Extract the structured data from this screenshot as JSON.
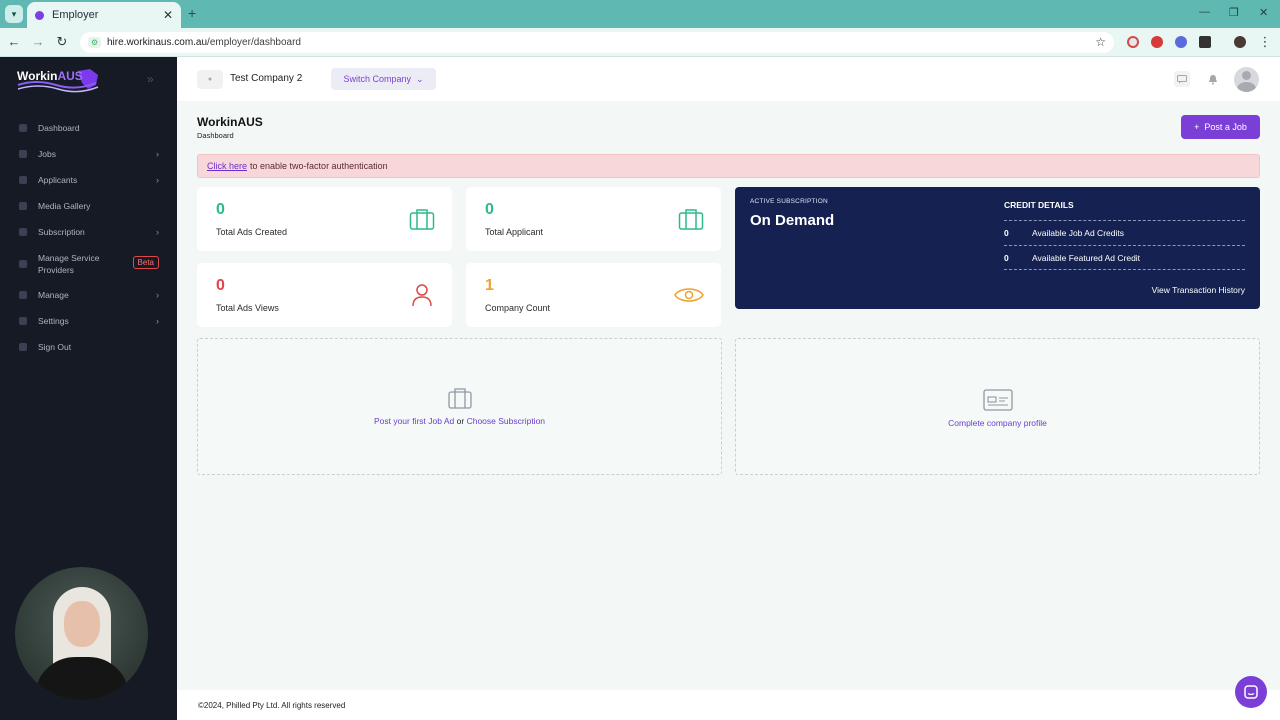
{
  "browser": {
    "tab_title": "Employer",
    "tab_close": "✕",
    "new_tab": "+",
    "url_host": "hire.workinaus.com.au",
    "url_path": "/employer/dashboard",
    "window_controls": [
      "—",
      "❐",
      "✕"
    ]
  },
  "sidebar": {
    "logo_text_a": "Workin",
    "logo_text_b": "AUS",
    "items": [
      {
        "label": "Dashboard",
        "icon": "dashboard-icon",
        "chevron": false
      },
      {
        "label": "Jobs",
        "icon": "jobs-icon",
        "chevron": true
      },
      {
        "label": "Applicants",
        "icon": "applicants-icon",
        "chevron": true
      },
      {
        "label": "Media Gallery",
        "icon": "media-icon",
        "chevron": false
      },
      {
        "label": "Subscription",
        "icon": "subscription-icon",
        "chevron": true
      },
      {
        "label": "Manage Service Providers",
        "icon": "providers-icon",
        "chevron": false,
        "badge": "Beta"
      },
      {
        "label": "Manage",
        "icon": "manage-icon",
        "chevron": true
      },
      {
        "label": "Settings",
        "icon": "settings-icon",
        "chevron": true
      },
      {
        "label": "Sign Out",
        "icon": "signout-icon",
        "chevron": false
      }
    ]
  },
  "topbar": {
    "company_name": "Test Company 2",
    "switch_label": "Switch Company"
  },
  "header": {
    "title": "WorkinAUS",
    "subtitle": "Dashboard",
    "post_button": "Post a Job"
  },
  "alert": {
    "link_text": "Click here",
    "message": "to enable two-factor authentication"
  },
  "stats": [
    {
      "value": "0",
      "label": "Total Ads Created",
      "color": "#2fb98a",
      "icon": "briefcase-icon"
    },
    {
      "value": "0",
      "label": "Total Applicant",
      "color": "#2fb98a",
      "icon": "briefcase-icon"
    },
    {
      "value": "0",
      "label": "Total Ads Views",
      "color": "#e04646",
      "icon": "person-icon"
    },
    {
      "value": "1",
      "label": "Company Count",
      "color": "#f0a22c",
      "icon": "eye-icon"
    }
  ],
  "subscription": {
    "label": "ACTIVE SUBSCRIPTION",
    "value": "On Demand",
    "credit_title": "CREDIT DETAILS",
    "credits": [
      {
        "count": "0",
        "label": "Available Job Ad Credits"
      },
      {
        "count": "0",
        "label": "Available Featured Ad Credit"
      }
    ],
    "history_link": "View Transaction History"
  },
  "empty_states": {
    "post_first": "Post your first Job Ad",
    "or": "or",
    "choose_sub": "Choose Subscription",
    "complete_profile": "Complete company profile"
  },
  "footer": {
    "text": "©2024, Philled Pty Ltd. All rights reserved"
  }
}
